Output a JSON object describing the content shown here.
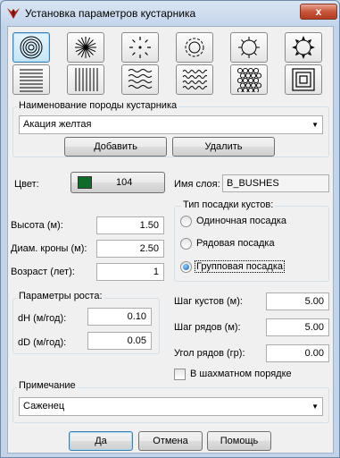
{
  "window": {
    "title": "Установка параметров кустарника",
    "close_label": "x"
  },
  "patterns": {
    "selected_index": 0,
    "items": [
      "concentric-circles-icon",
      "starburst-icon",
      "dashed-circle-icon",
      "scalloped-circle-icon",
      "spiked-circle-icon",
      "pointed-circle-icon",
      "horizontal-lines-icon",
      "vertical-lines-icon",
      "wavy-lines-icon",
      "wave-pattern-icon",
      "honeycomb-icon",
      "concentric-squares-icon"
    ]
  },
  "species": {
    "group_label": "Наименование породы кустарника",
    "value": "Акация желтая",
    "add_label": "Добавить",
    "delete_label": "Удалить"
  },
  "color": {
    "label": "Цвет:",
    "swatch": "#0f6b2a",
    "value": "104"
  },
  "layer": {
    "label": "Имя слоя:",
    "value": "B_BUSHES"
  },
  "fields": {
    "height_label": "Высота (м):",
    "height_value": "1.50",
    "crown_label": "Диам. кроны (м):",
    "crown_value": "2.50",
    "age_label": "Возраст (лет):",
    "age_value": "1"
  },
  "planting": {
    "group_label": "Тип посадки кустов:",
    "options": [
      "Одиночная посадка",
      "Рядовая посадка",
      "Групповая посадка"
    ],
    "selected_index": 2
  },
  "growth": {
    "group_label": "Параметры роста:",
    "dh_label": "dH (м/год):",
    "dh_value": "0.10",
    "dd_label": "dD (м/год):",
    "dd_value": "0.05"
  },
  "spacing": {
    "bush_step_label": "Шаг кустов (м):",
    "bush_step_value": "5.00",
    "row_step_label": "Шаг рядов (м):",
    "row_step_value": "5.00",
    "row_angle_label": "Угол рядов (гр):",
    "row_angle_value": "0.00",
    "checker_label": "В шахматном порядке",
    "checker_checked": false
  },
  "note": {
    "group_label": "Примечание",
    "value": "Саженец"
  },
  "buttons": {
    "ok": "Да",
    "cancel": "Отмена",
    "help": "Помощь"
  }
}
